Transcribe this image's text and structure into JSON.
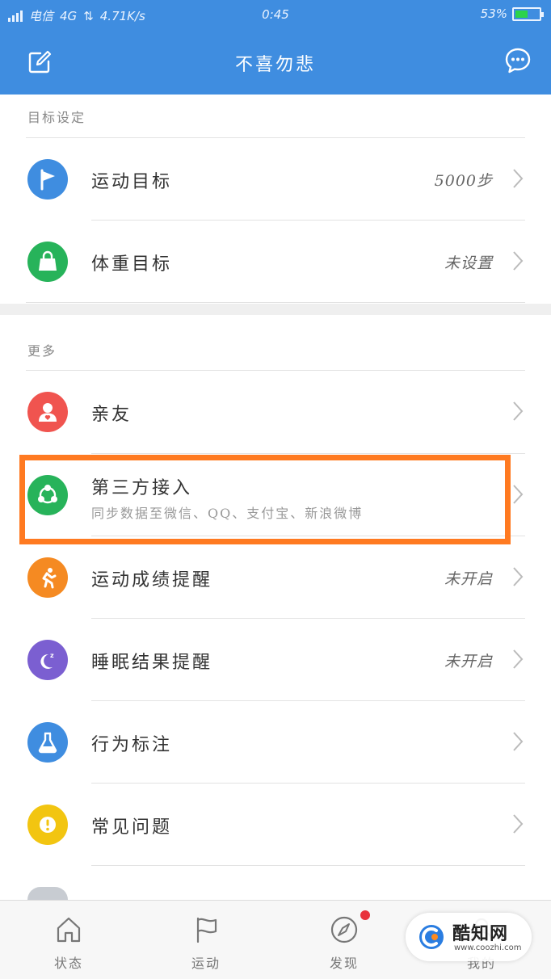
{
  "status_bar": {
    "carrier": "电信",
    "network": "4G",
    "speed": "4.71K/s",
    "time": "0:45",
    "battery_percent": "53%",
    "battery_level": 0.53
  },
  "header": {
    "title": "不喜勿悲",
    "edit_icon": "edit-icon",
    "chat_icon": "chat-bubble-icon",
    "bg_color": "#3f8de0"
  },
  "sections": {
    "goals": {
      "header": "目标设定",
      "items": [
        {
          "label": "运动目标",
          "value": "5000步",
          "icon": "flag-icon",
          "color": "#3f8de0"
        },
        {
          "label": "体重目标",
          "value": "未设置",
          "icon": "bag-icon",
          "color": "#27b35a"
        }
      ]
    },
    "more": {
      "header": "更多",
      "items": [
        {
          "label": "亲友",
          "value": "",
          "icon": "friends-icon",
          "color": "#f0544f"
        },
        {
          "label": "第三方接入",
          "subtitle": "同步数据至微信、QQ、支付宝、新浪微博",
          "value": "",
          "icon": "share-icon",
          "color": "#27b35a"
        },
        {
          "label": "运动成绩提醒",
          "value": "未开启",
          "icon": "runner-icon",
          "color": "#f58a22"
        },
        {
          "label": "睡眠结果提醒",
          "value": "未开启",
          "icon": "moon-icon",
          "color": "#7b5fd1"
        },
        {
          "label": "行为标注",
          "value": "",
          "icon": "flask-icon",
          "color": "#3f8de0"
        },
        {
          "label": "常见问题",
          "value": "",
          "icon": "alert-icon",
          "color": "#f2c511"
        }
      ]
    }
  },
  "tab_bar": {
    "tabs": [
      {
        "label": "状态",
        "icon": "home-icon"
      },
      {
        "label": "运动",
        "icon": "flag-outline-icon"
      },
      {
        "label": "发现",
        "icon": "compass-icon",
        "badge": true
      },
      {
        "label": "我的",
        "icon": "profile-icon"
      }
    ]
  },
  "watermark": {
    "brand": "酷知网",
    "url": "www.coozhi.com"
  },
  "highlight_color": "#ff7a21"
}
